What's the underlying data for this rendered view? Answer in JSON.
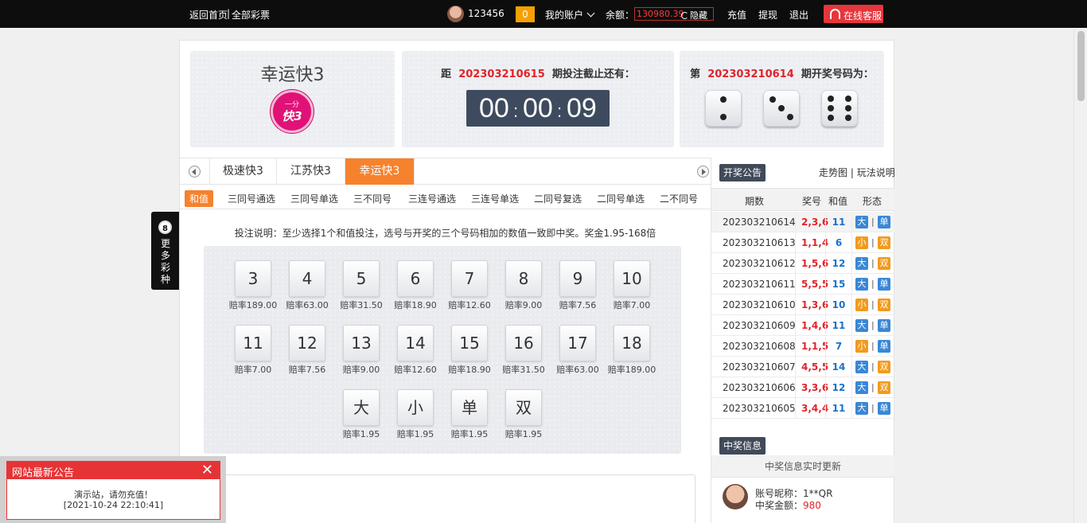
{
  "topbar": {
    "home_link": "返回首页",
    "divider": "|",
    "all_lottery": "全部彩票",
    "username": "123456",
    "msg_count": "0",
    "my_account": "我的账户",
    "balance_label": "余额：",
    "balance_value": "130980.39",
    "hide": "隐藏",
    "recharge": "充值",
    "withdraw": "提现",
    "logout": "退出",
    "online_service": "在线客服"
  },
  "game": {
    "title": "幸运快3",
    "logo_top": "一分",
    "logo_main": "快3"
  },
  "countdown": {
    "prefix": "距",
    "issue": "202303210615",
    "suffix": "期投注截止还有：",
    "hh": "00",
    "mm": "00",
    "ss": "09",
    "colon": ":"
  },
  "last_result": {
    "prefix": "第",
    "issue": "202303210614",
    "suffix": "期开奖号码为：",
    "dice": [
      2,
      3,
      6
    ]
  },
  "tabs": [
    {
      "label": "极速快3"
    },
    {
      "label": "江苏快3"
    },
    {
      "label": "幸运快3"
    }
  ],
  "subtabs": [
    {
      "label": "和值"
    },
    {
      "label": "三同号通选"
    },
    {
      "label": "三同号单选"
    },
    {
      "label": "三不同号"
    },
    {
      "label": "三连号通选"
    },
    {
      "label": "三连号单选"
    },
    {
      "label": "二同号复选"
    },
    {
      "label": "二同号单选"
    },
    {
      "label": "二不同号"
    }
  ],
  "instructions": "投注说明：至少选择1个和值投注，选号与开奖的三个号码相加的数值一致即中奖。奖金1.95-168倍",
  "bet_rows": [
    [
      {
        "label": "3",
        "odds": "赔率189.00"
      },
      {
        "label": "4",
        "odds": "赔率63.00"
      },
      {
        "label": "5",
        "odds": "赔率31.50"
      },
      {
        "label": "6",
        "odds": "赔率18.90"
      },
      {
        "label": "7",
        "odds": "赔率12.60"
      },
      {
        "label": "8",
        "odds": "赔率9.00"
      },
      {
        "label": "9",
        "odds": "赔率7.56"
      },
      {
        "label": "10",
        "odds": "赔率7.00"
      }
    ],
    [
      {
        "label": "11",
        "odds": "赔率7.00"
      },
      {
        "label": "12",
        "odds": "赔率7.56"
      },
      {
        "label": "13",
        "odds": "赔率9.00"
      },
      {
        "label": "14",
        "odds": "赔率12.60"
      },
      {
        "label": "15",
        "odds": "赔率18.90"
      },
      {
        "label": "16",
        "odds": "赔率31.50"
      },
      {
        "label": "17",
        "odds": "赔率63.00"
      },
      {
        "label": "18",
        "odds": "赔率189.00"
      }
    ],
    [
      {
        "label": "大",
        "odds": "赔率1.95"
      },
      {
        "label": "小",
        "odds": "赔率1.95"
      },
      {
        "label": "单",
        "odds": "赔率1.95"
      },
      {
        "label": "双",
        "odds": "赔率1.95"
      }
    ]
  ],
  "side_more": {
    "ball": "8",
    "text": "更多彩种"
  },
  "results_panel": {
    "title": "开奖公告",
    "trend_link": "走势图",
    "divider": "|",
    "rules_link": "玩法说明",
    "headers": [
      "期数",
      "奖号",
      "和值",
      "形态"
    ],
    "sep": "|",
    "rows": [
      {
        "issue": "202303210614",
        "nums": "2,3,6",
        "sum": "11",
        "size": "大",
        "parity": "单"
      },
      {
        "issue": "202303210613",
        "nums": "1,1,4",
        "sum": "6",
        "size": "小",
        "parity": "双"
      },
      {
        "issue": "202303210612",
        "nums": "1,5,6",
        "sum": "12",
        "size": "大",
        "parity": "双"
      },
      {
        "issue": "202303210611",
        "nums": "5,5,5",
        "sum": "15",
        "size": "大",
        "parity": "单"
      },
      {
        "issue": "202303210610",
        "nums": "1,3,6",
        "sum": "10",
        "size": "小",
        "parity": "双"
      },
      {
        "issue": "202303210609",
        "nums": "1,4,6",
        "sum": "11",
        "size": "大",
        "parity": "单"
      },
      {
        "issue": "202303210608",
        "nums": "1,1,5",
        "sum": "7",
        "size": "小",
        "parity": "单"
      },
      {
        "issue": "202303210607",
        "nums": "4,5,5",
        "sum": "14",
        "size": "大",
        "parity": "双"
      },
      {
        "issue": "202303210606",
        "nums": "3,3,6",
        "sum": "12",
        "size": "大",
        "parity": "双"
      },
      {
        "issue": "202303210605",
        "nums": "3,4,4",
        "sum": "11",
        "size": "大",
        "parity": "单"
      }
    ]
  },
  "winners": {
    "title": "中奖信息",
    "subtitle": "中奖信息实时更新",
    "nick_label": "账号昵称：",
    "nick": "1**QR",
    "amount_label": "中奖金额：",
    "amount": "980"
  },
  "notice": {
    "title": "网站最新公告",
    "close": "✕",
    "line1": "演示站，请勿充值！",
    "line2": "[2021-10-24 22:10:41]"
  },
  "colors": {
    "accent_orange": "#f6822d",
    "red": "#e0242a",
    "blue": "#3a87d6",
    "dark": "#404a59"
  }
}
